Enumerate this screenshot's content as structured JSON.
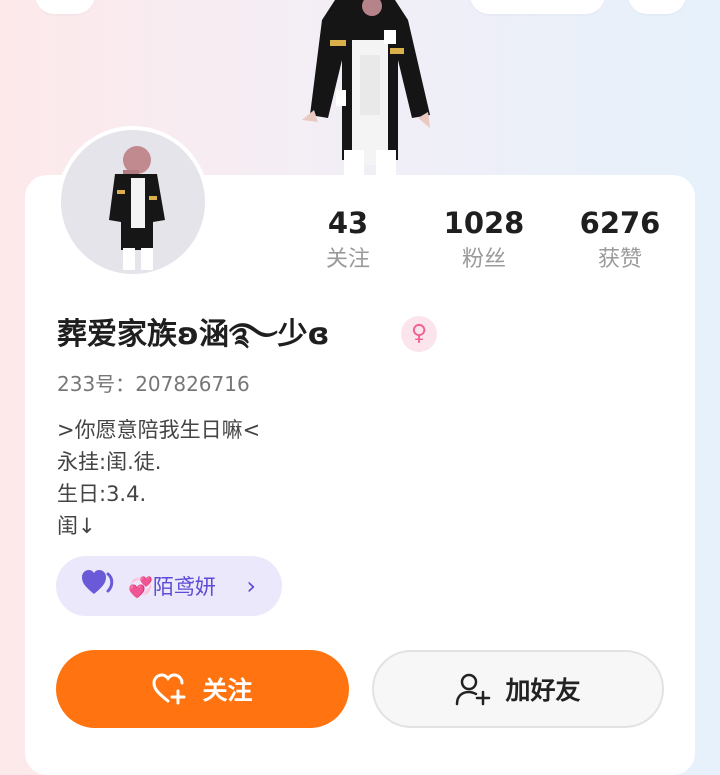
{
  "profile": {
    "name": "葬爱家族ʚ涵࿐少ɞ",
    "uid_label": "233号：",
    "uid": "207826716",
    "gender_symbol": "♀"
  },
  "stats": [
    {
      "value": "43",
      "label": "关注"
    },
    {
      "value": "1028",
      "label": "粉丝"
    },
    {
      "value": "6276",
      "label": "获赞"
    }
  ],
  "bio": [
    ">你愿意陪我生日嘛<",
    "永挂:闺.徒.",
    "生日:3.4.",
    "闺↓"
  ],
  "fan_club": {
    "emoji": "💞",
    "name": "陌鸢妍",
    "chevron": "›"
  },
  "actions": {
    "follow_label": "关注",
    "add_friend_label": "加好友"
  },
  "colors": {
    "accent": "#ff7410",
    "fan_pill_bg": "#ebe8fb",
    "fan_text": "#5c4bd3",
    "gender_bg": "#fce4ec"
  }
}
